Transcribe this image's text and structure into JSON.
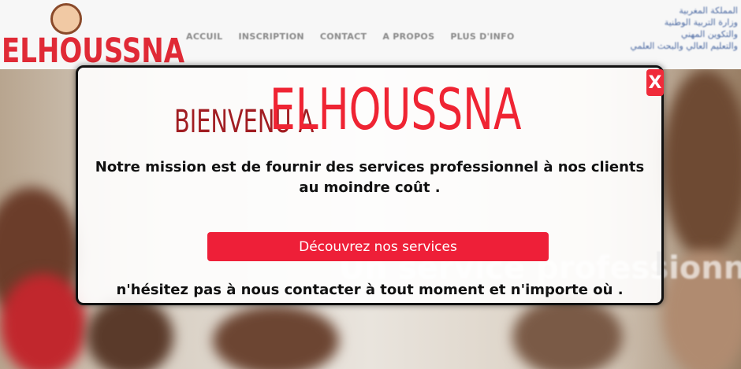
{
  "header": {
    "logo_text": "ELHOUSSNA",
    "nav": [
      "ACCUIL",
      "INSCRIPTION",
      "CONTACT",
      "A PROPOS",
      "PLUS D'INFO"
    ],
    "arabic_lines": [
      "المملكة المغربية",
      "وزارة التربية الوطنية",
      "والتكوين المهني",
      "والتعليم العالي والبحث العلمي"
    ]
  },
  "hero": {
    "background_text": "Un service professionne",
    "background_text_tail": "l"
  },
  "modal": {
    "close_label": "X",
    "title_prefix": "BIENVENU A",
    "title_brand": "ELHOUSSNA",
    "mission_line1": "Notre mission est de fournir des services professionnel à nos clients",
    "mission_line2": "au moindre coût .",
    "cta_label": "Découvrez nos services",
    "contact_text": "n'hésitez pas à nous contacter à tout moment et n'importe où ."
  },
  "colors": {
    "accent_red": "#ee1f38",
    "title_dark_red": "#a11d22",
    "brand_red": "#ef2433"
  }
}
